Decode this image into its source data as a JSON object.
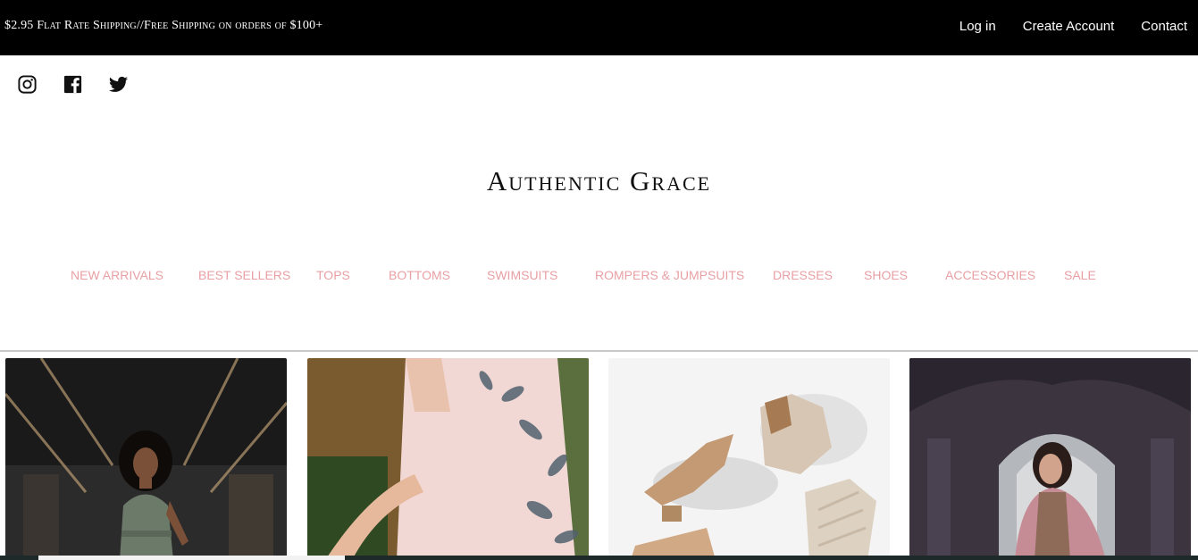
{
  "topbar": {
    "promo": "$2.95 Flat Rate Shipping//Free Shipping on orders of $100+",
    "links": [
      "Log in",
      "Create Account",
      "Contact"
    ]
  },
  "social": [
    "instagram-icon",
    "facebook-icon",
    "twitter-icon"
  ],
  "brand": {
    "name": "Authentic Grace"
  },
  "nav": {
    "items": [
      "NEW ARRIVALS",
      "BEST SELLERS",
      "TOPS",
      "BOTTOMS",
      "SWIMSUITS",
      "ROMPERS & JUMPSUITS",
      "DRESSES",
      "SHOES",
      "ACCESSORIES",
      "SALE"
    ],
    "color": "#e8a0a4"
  },
  "tiles": [
    {
      "name": "woman-green-jumpsuit-photo"
    },
    {
      "name": "floral-dress-photo"
    },
    {
      "name": "shoes-photo"
    },
    {
      "name": "woman-arcade-photo"
    }
  ],
  "colors": {
    "topbar": "#000000",
    "nav": "#e8a0a4",
    "text": "#111111"
  }
}
